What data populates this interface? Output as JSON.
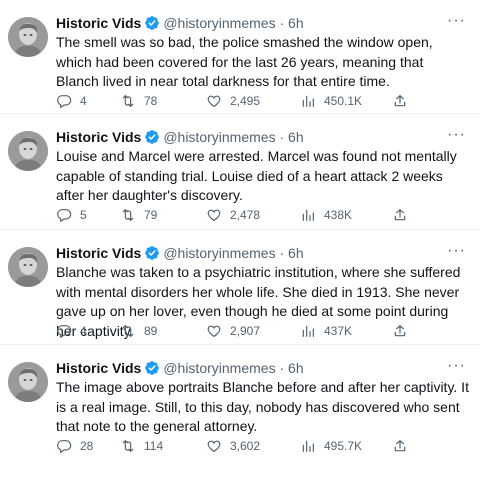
{
  "tweets": [
    {
      "name": "Historic Vids",
      "handle": "@historyinmemes",
      "separator": "·",
      "time": "6h",
      "text": "The smell was so bad, the police smashed the window open, which had been covered for the last 26 years, meaning that Blanch lived in near total darkness for that entire time.",
      "replies": "4",
      "retweets": "78",
      "likes": "2,495",
      "views": "450.1K"
    },
    {
      "name": "Historic Vids",
      "handle": "@historyinmemes",
      "separator": "·",
      "time": "6h",
      "text": "Louise and Marcel were arrested. Marcel was found not mentally capable of standing trial. Louise died of a heart attack 2 weeks after her daughter's discovery.",
      "replies": "5",
      "retweets": "79",
      "likes": "2,478",
      "views": "438K"
    },
    {
      "name": "Historic Vids",
      "handle": "@historyinmemes",
      "separator": "·",
      "time": "6h",
      "text": "Blanche was taken to a psychiatric institution, where she suffered with mental disorders her whole life. She died in 1913. She never gave up on her lover, even though he died at some point during her captivity.",
      "replies": "4",
      "retweets": "89",
      "likes": "2,907",
      "views": "437K"
    },
    {
      "name": "Historic Vids",
      "handle": "@historyinmemes",
      "separator": "·",
      "time": "6h",
      "text": "The image above portraits Blanche before and after her captivity. It is a real image. Still, to this day, nobody has discovered who sent that note to the general attorney.",
      "replies": "28",
      "retweets": "114",
      "likes": "3,602",
      "views": "495.7K"
    }
  ],
  "colors": {
    "text": "#0f1419",
    "muted": "#536471",
    "verified": "#1d9bf0",
    "divider": "#eff3f4"
  },
  "icons": [
    "verified-badge-icon",
    "more-icon",
    "reply-icon",
    "retweet-icon",
    "like-icon",
    "views-icon",
    "share-icon"
  ]
}
